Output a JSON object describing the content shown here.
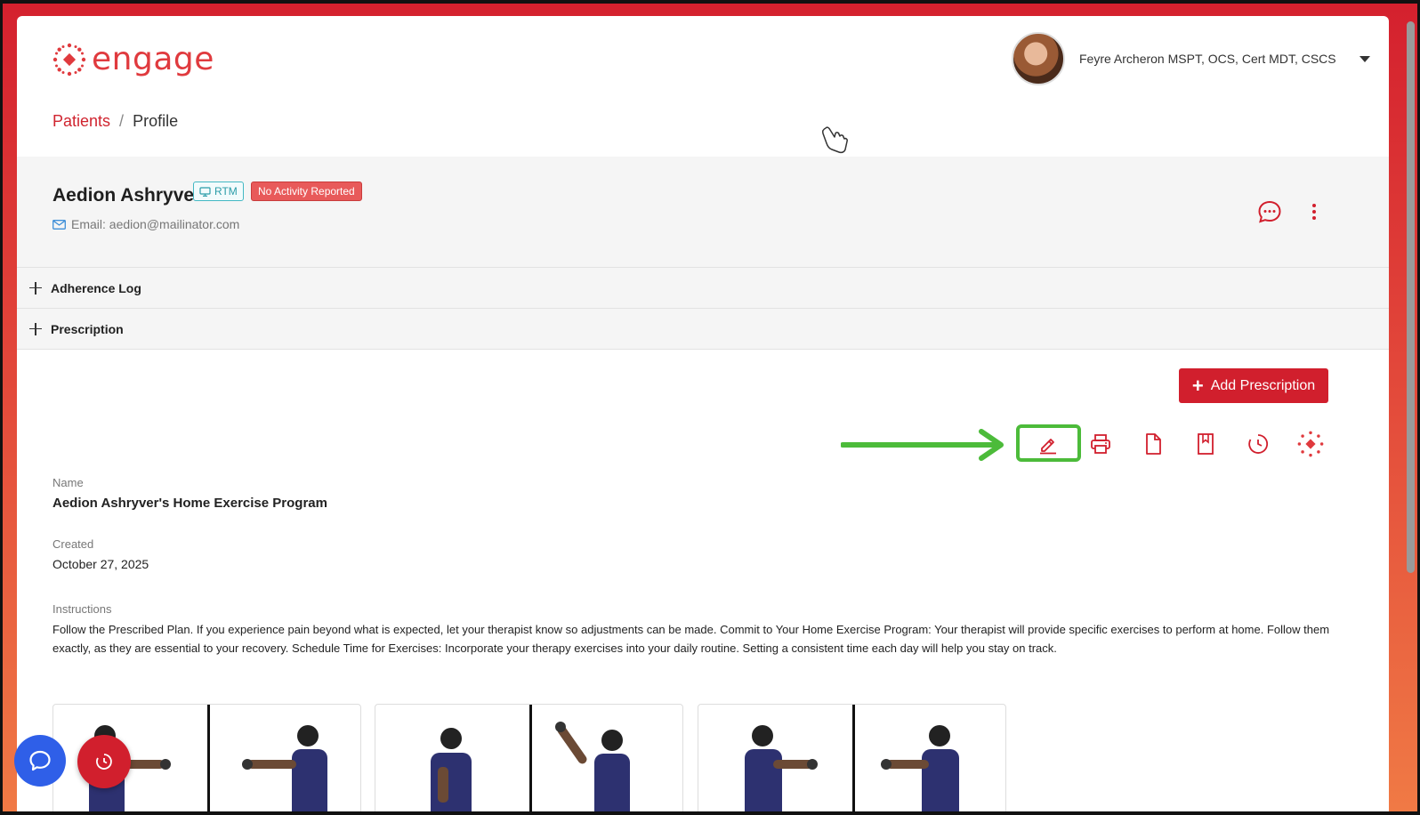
{
  "app": {
    "logo_text": "engage",
    "brand_color": "#d11f2d"
  },
  "user": {
    "name": "Feyre Archeron MSPT, OCS, Cert MDT, CSCS"
  },
  "breadcrumb": {
    "link": "Patients",
    "separator": "/",
    "current": "Profile"
  },
  "patient": {
    "name": "Aedion Ashryver",
    "rtm_badge": "RTM",
    "status_badge": "No Activity Reported",
    "email": "Email: aedion@mailinator.com"
  },
  "sections": [
    {
      "label": "Adherence Log"
    },
    {
      "label": "Prescription"
    }
  ],
  "prescription": {
    "add_button_label": "Add Prescription",
    "toolbar_icons": [
      "edit-icon",
      "print-icon",
      "document-icon",
      "bookmark-icon",
      "history-icon",
      "engage-logo-icon"
    ],
    "name_label": "Name",
    "name_value": "Aedion Ashryver's Home Exercise Program",
    "created_label": "Created",
    "created_value": "October 27, 2025",
    "instructions_label": "Instructions",
    "instructions_text": "Follow the Prescribed Plan. If you experience pain beyond what is expected, let your therapist know so adjustments can be made. Commit to Your Home Exercise Program: Your therapist will provide specific exercises to perform at home. Follow them exactly, as they are essential to your recovery. Schedule Time for Exercises: Incorporate your therapy exercises into your daily routine. Setting a consistent time each day will help you stay on track."
  },
  "exercises": [
    {
      "name": "exercise-card-1"
    },
    {
      "name": "exercise-card-2"
    },
    {
      "name": "exercise-card-3"
    }
  ]
}
